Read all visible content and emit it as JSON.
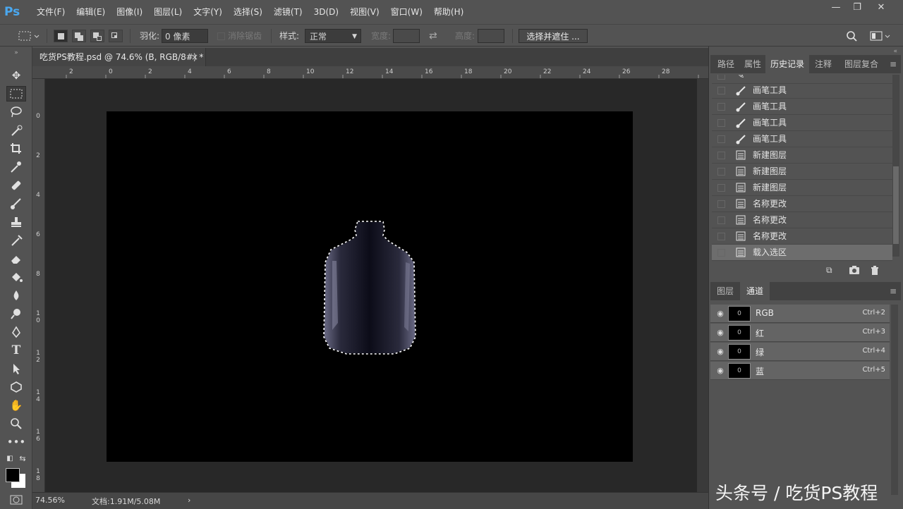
{
  "app": {
    "logo": "Ps",
    "menu": [
      "文件(F)",
      "编辑(E)",
      "图像(I)",
      "图层(L)",
      "文字(Y)",
      "选择(S)",
      "滤镜(T)",
      "3D(D)",
      "视图(V)",
      "窗口(W)",
      "帮助(H)"
    ],
    "window_buttons": {
      "minimize": "—",
      "restore": "❐",
      "close": "✕"
    }
  },
  "options": {
    "feather_label": "羽化:",
    "feather_value": "0 像素",
    "antialias_label": "消除锯齿",
    "style_label": "样式:",
    "style_value": "正常",
    "width_label": "宽度:",
    "height_label": "高度:",
    "select_mask_button": "选择并遮住 ..."
  },
  "document": {
    "tab_title": "吃货PS教程.psd @ 74.6% (B, RGB/8#) *",
    "tab_close": "×",
    "ruler_top": [
      "2",
      "0",
      "2",
      "4",
      "6",
      "8",
      "10",
      "12",
      "14",
      "16",
      "18",
      "20",
      "22",
      "24",
      "26",
      "28"
    ],
    "ruler_left": [
      "0",
      "2",
      "4",
      "6",
      "8",
      "1\n0",
      "1\n2",
      "1\n4",
      "1\n6",
      "1\n8"
    ],
    "status": {
      "zoom": "74.56%",
      "doc_info": "文档:1.91M/5.08M",
      "arrow": "›"
    }
  },
  "history_panel": {
    "tabs": [
      "路径",
      "属性",
      "历史记录",
      "注释",
      "图层复合"
    ],
    "active_tab": "历史记录",
    "items": [
      {
        "icon": "brush-icon",
        "label": "画笔工具"
      },
      {
        "icon": "brush-icon",
        "label": "画笔工具"
      },
      {
        "icon": "brush-icon",
        "label": "画笔工具"
      },
      {
        "icon": "brush-icon",
        "label": "画笔工具"
      },
      {
        "icon": "layer-icon",
        "label": "新建图层"
      },
      {
        "icon": "layer-icon",
        "label": "新建图层"
      },
      {
        "icon": "layer-icon",
        "label": "新建图层"
      },
      {
        "icon": "layer-icon",
        "label": "名称更改"
      },
      {
        "icon": "layer-icon",
        "label": "名称更改"
      },
      {
        "icon": "layer-icon",
        "label": "名称更改"
      },
      {
        "icon": "layer-icon",
        "label": "载入选区"
      }
    ],
    "selected_index": 10
  },
  "channels_panel": {
    "tabs": [
      "图层",
      "通道"
    ],
    "active_tab": "通道",
    "channels": [
      {
        "name": "RGB",
        "shortcut": "Ctrl+2",
        "thumb": "0"
      },
      {
        "name": "红",
        "shortcut": "Ctrl+3",
        "thumb": "0"
      },
      {
        "name": "绿",
        "shortcut": "Ctrl+4",
        "thumb": "0"
      },
      {
        "name": "蓝",
        "shortcut": "Ctrl+5",
        "thumb": "0"
      }
    ]
  },
  "watermark": "头条号 / 吃货PS教程",
  "colors": {
    "ps_blue": "#4aa8f0",
    "ui_gray": "#535353",
    "pasteboard": "#282828",
    "canvas": "#000000"
  }
}
